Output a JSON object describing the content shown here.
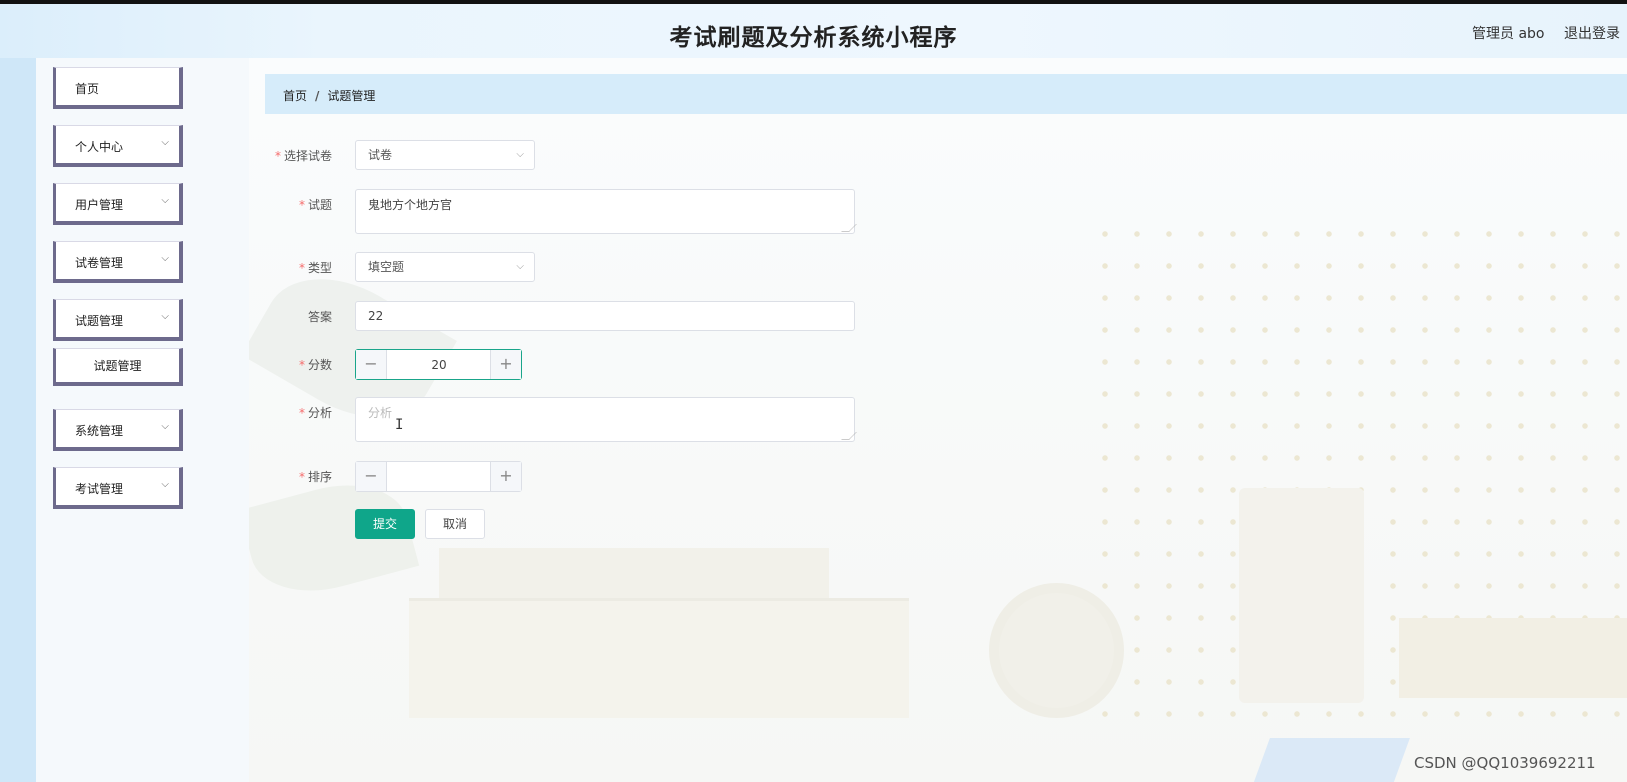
{
  "header": {
    "title": "考试刷题及分析系统小程序",
    "user": "管理员 abo",
    "logout": "退出登录"
  },
  "sidebar": {
    "items": [
      {
        "label": "首页",
        "has_children": false
      },
      {
        "label": "个人中心",
        "has_children": true
      },
      {
        "label": "用户管理",
        "has_children": true
      },
      {
        "label": "试卷管理",
        "has_children": true
      },
      {
        "label": "试题管理",
        "has_children": true,
        "expanded": true,
        "children": [
          {
            "label": "试题管理"
          }
        ]
      },
      {
        "label": "系统管理",
        "has_children": true
      },
      {
        "label": "考试管理",
        "has_children": true
      }
    ],
    "chevron": "⌵"
  },
  "breadcrumb": {
    "home": "首页",
    "separator": "/",
    "current": "试题管理"
  },
  "form": {
    "paper": {
      "label": "选择试卷",
      "value": "试卷",
      "required": true
    },
    "question": {
      "label": "试题",
      "value": "鬼地方个地方官",
      "required": true
    },
    "type": {
      "label": "类型",
      "value": "填空题",
      "required": true
    },
    "answer": {
      "label": "答案",
      "value": "22",
      "required": false
    },
    "score": {
      "label": "分数",
      "value": "20",
      "required": true
    },
    "analysis": {
      "label": "分析",
      "value": "",
      "placeholder": "分析",
      "required": true
    },
    "sort": {
      "label": "排序",
      "value": "",
      "required": true
    },
    "submit": "提交",
    "cancel": "取消",
    "required_mark": "*",
    "minus": "−",
    "plus": "+"
  },
  "watermark": "CSDN @QQ1039692211"
}
